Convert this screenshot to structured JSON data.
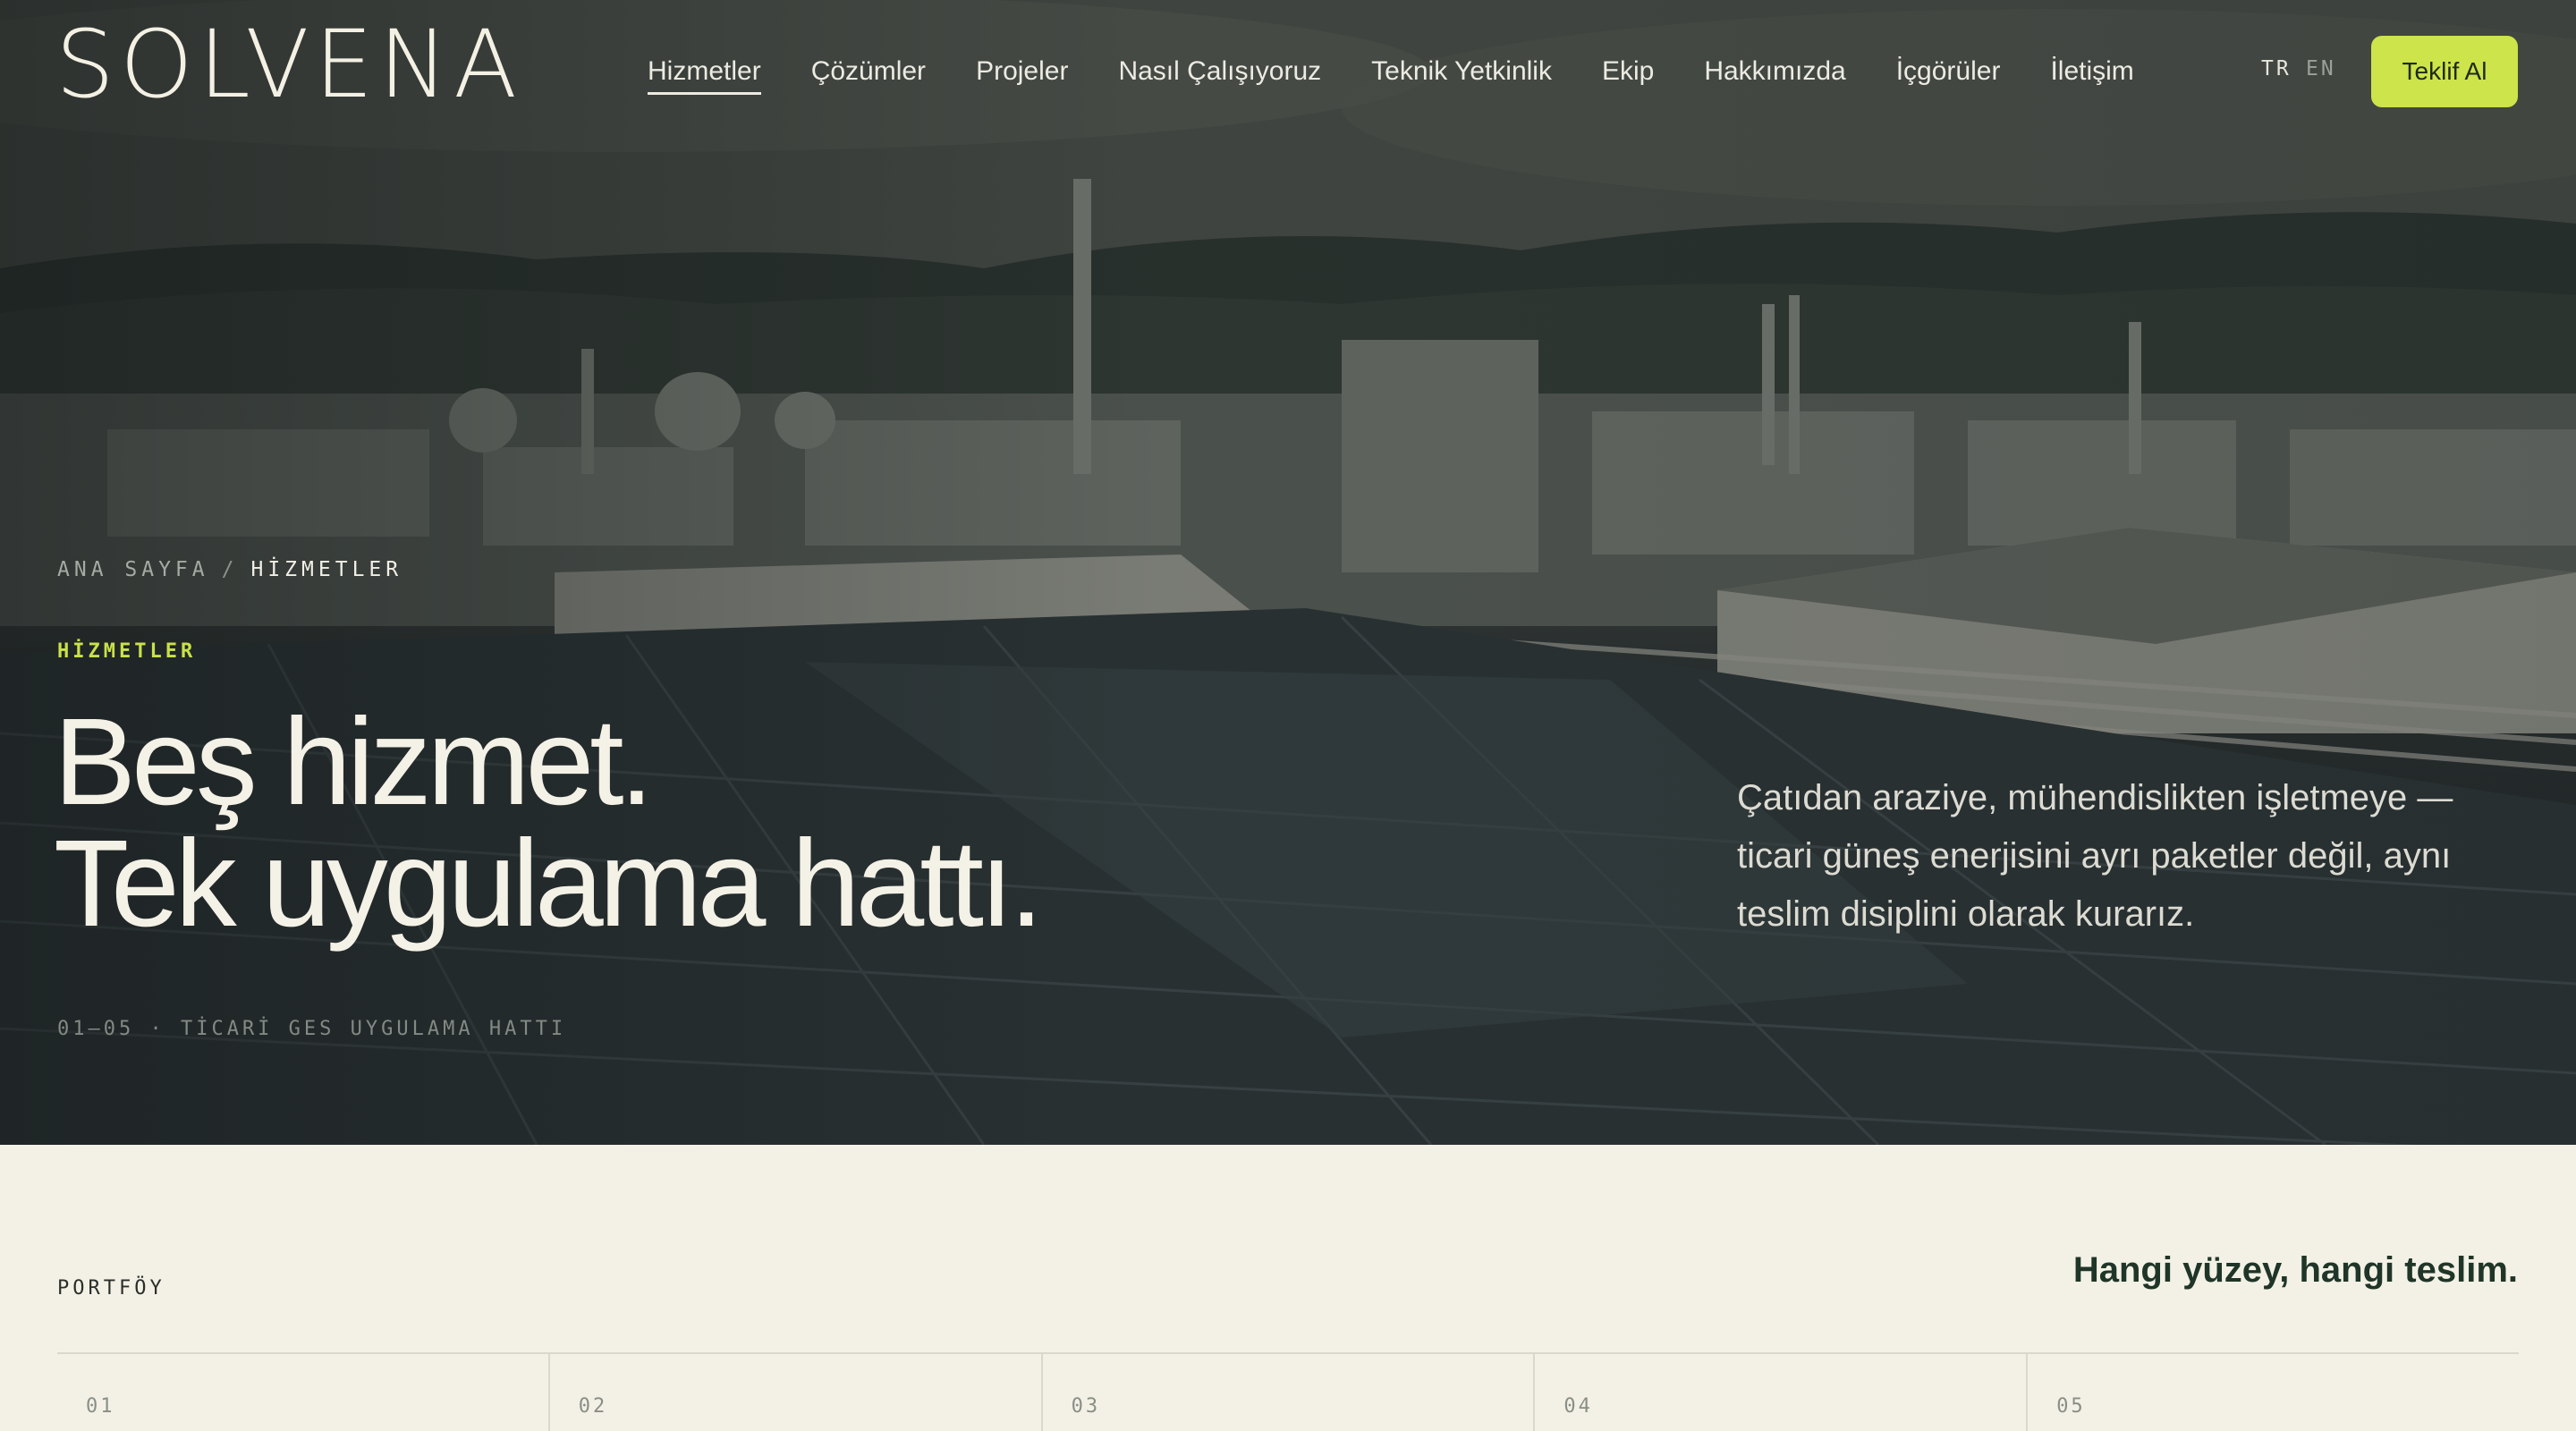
{
  "brand": {
    "logo_text": "SOLVENA"
  },
  "nav": {
    "links": [
      {
        "label": "Hizmetler",
        "active": true
      },
      {
        "label": "Çözümler"
      },
      {
        "label": "Projeler"
      },
      {
        "label": "Nasıl Çalışıyoruz"
      },
      {
        "label": "Teknik Yetkinlik"
      },
      {
        "label": "Ekip"
      },
      {
        "label": "Hakkımızda"
      },
      {
        "label": "İçgörüler"
      },
      {
        "label": "İletişim"
      }
    ],
    "lang_tr": "TR",
    "lang_en": "EN",
    "cta_label": "Teklif Al"
  },
  "hero": {
    "breadcrumb_home": "ANA SAYFA",
    "breadcrumb_sep": "/",
    "breadcrumb_current": "HİZMETLER",
    "eyebrow": "HİZMETLER",
    "headline_line1": "Beş hizmet.",
    "headline_line2": "Tek uygulama hattı.",
    "lede": "Çatıdan araziye, mühendislikten işletmeye — ticari güneş enerjisini ayrı paketler değil, aynı teslim disiplini olarak kurarız.",
    "meta": "01–05 · TİCARİ GES UYGULAMA HATTI"
  },
  "portfolio": {
    "label": "PORTFÖY",
    "title": "Hangi yüzey, hangi teslim.",
    "items": [
      "01",
      "02",
      "03",
      "04",
      "05"
    ]
  },
  "colors": {
    "accent": "#cde44a",
    "cream": "#f3f1e6",
    "dark_green": "#1f3527"
  }
}
